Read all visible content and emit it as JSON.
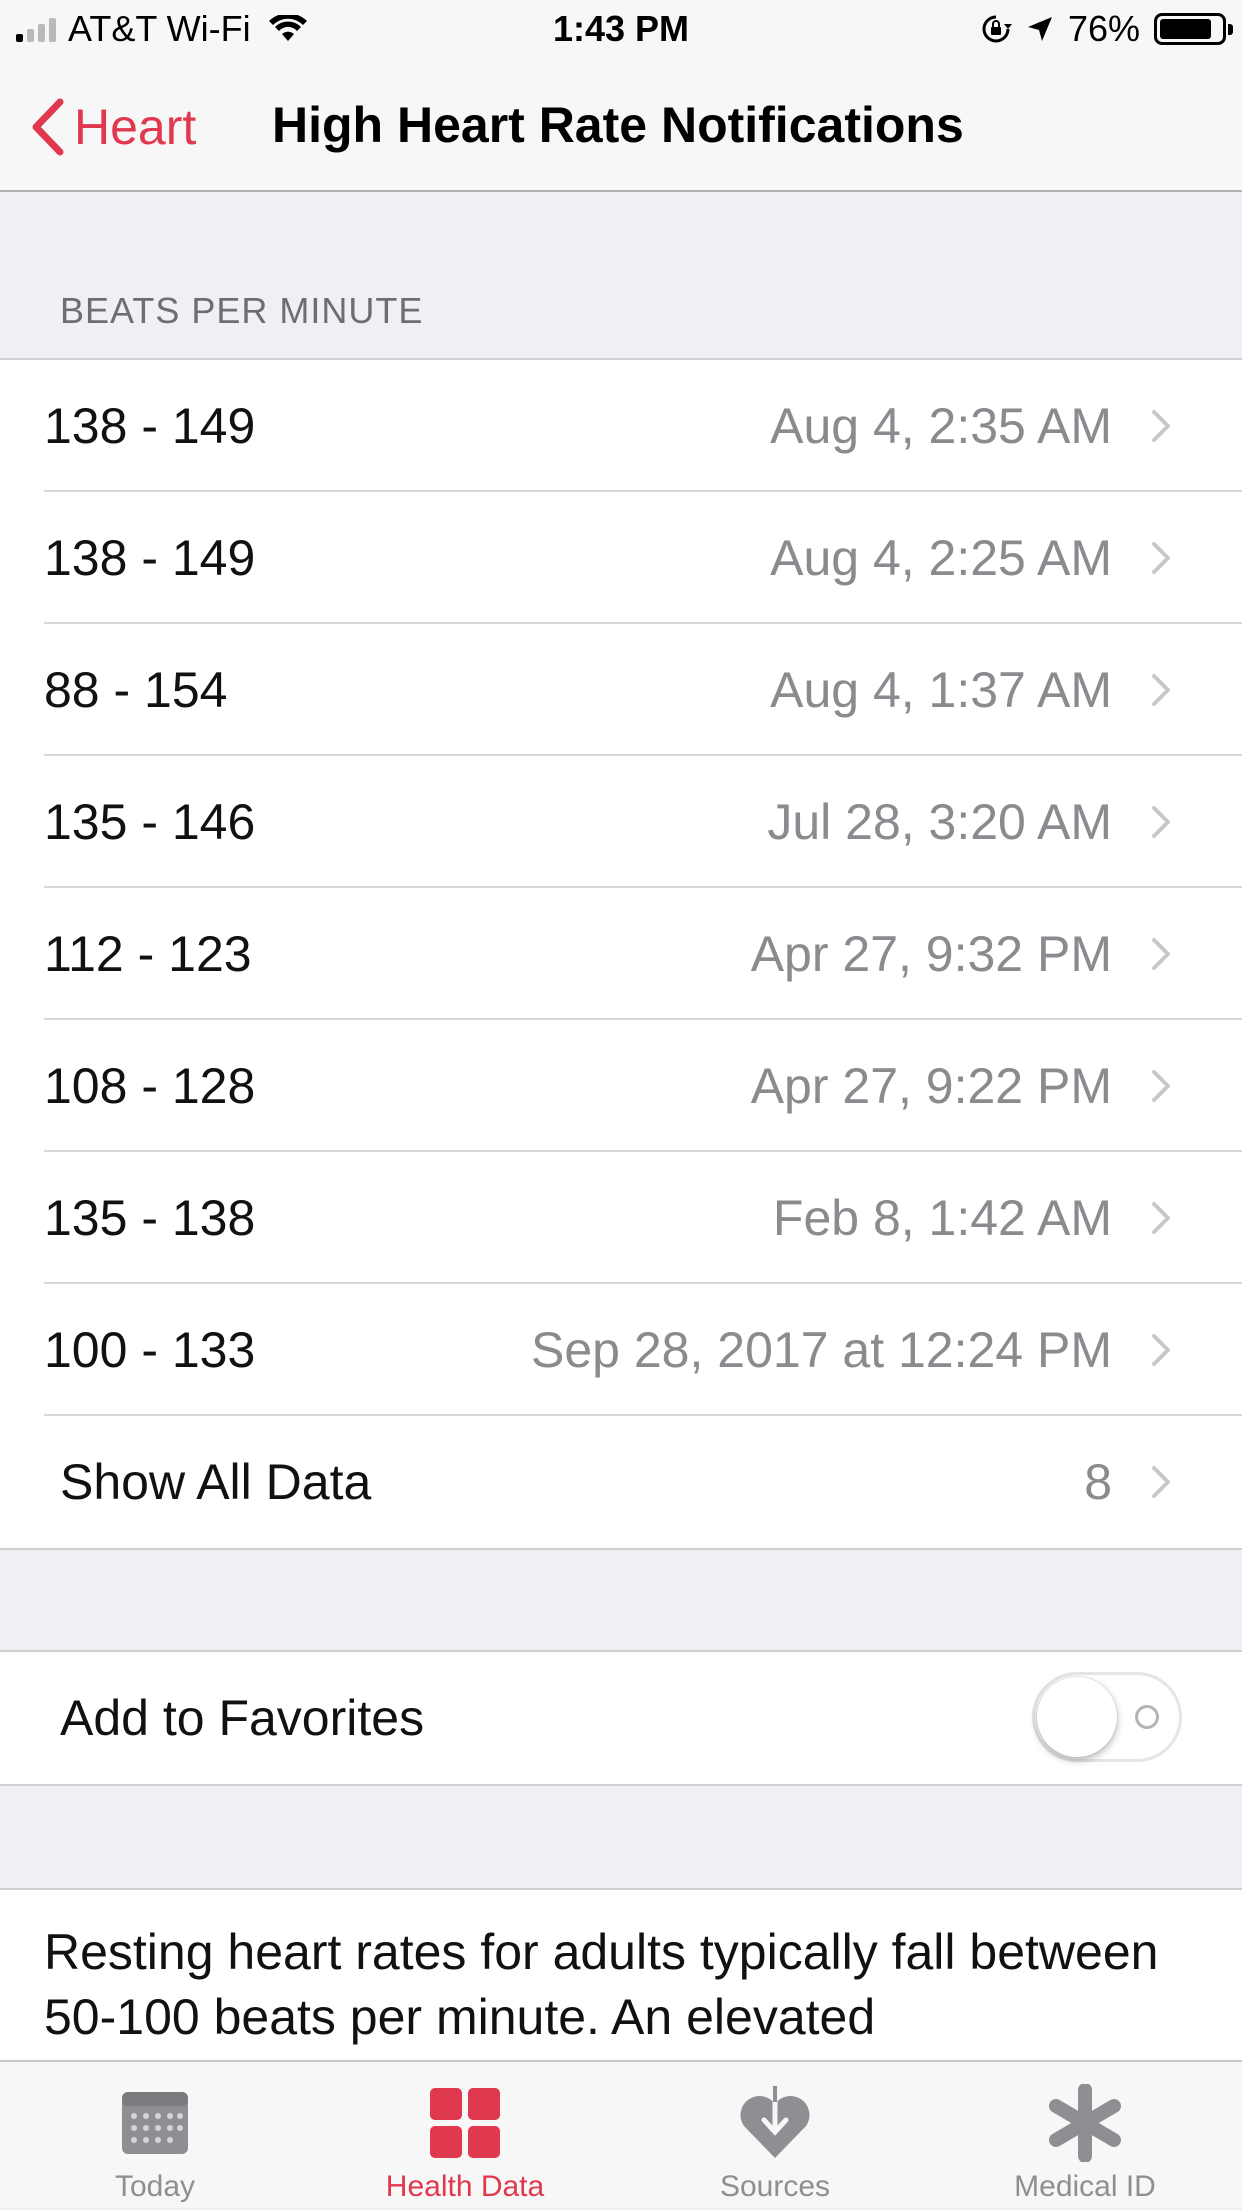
{
  "status_bar": {
    "carrier": "AT&T Wi-Fi",
    "time": "1:43 PM",
    "battery": "76%",
    "battery_level": 0.76
  },
  "nav": {
    "back_label": "Heart",
    "title": "High Heart Rate Notifications"
  },
  "section_header": "BEATS PER MINUTE",
  "rows": [
    {
      "range": "138 - 149",
      "date": "Aug 4, 2:35 AM"
    },
    {
      "range": "138 - 149",
      "date": "Aug 4, 2:25 AM"
    },
    {
      "range": "88 - 154",
      "date": "Aug 4, 1:37 AM"
    },
    {
      "range": "135 - 146",
      "date": "Jul 28, 3:20 AM"
    },
    {
      "range": "112 - 123",
      "date": "Apr 27, 9:32 PM"
    },
    {
      "range": "108 - 128",
      "date": "Apr 27, 9:22 PM"
    },
    {
      "range": "135 - 138",
      "date": "Feb 8, 1:42 AM"
    },
    {
      "range": "100 - 133",
      "date": "Sep 28, 2017 at 12:24 PM"
    }
  ],
  "show_all": {
    "label": "Show All Data",
    "count": "8"
  },
  "favorites": {
    "label": "Add to Favorites",
    "enabled": false
  },
  "description": "Resting heart rates for adults typically fall between 50-100 beats per minute. An elevated",
  "tabs": [
    {
      "label": "Today",
      "icon": "calendar-icon"
    },
    {
      "label": "Health Data",
      "icon": "grid-icon",
      "active": true
    },
    {
      "label": "Sources",
      "icon": "heart-download-icon"
    },
    {
      "label": "Medical ID",
      "icon": "asterisk-icon"
    }
  ],
  "colors": {
    "accent": "#e0384e",
    "secondary_text": "#8a8a8f",
    "background": "#efeff4"
  }
}
